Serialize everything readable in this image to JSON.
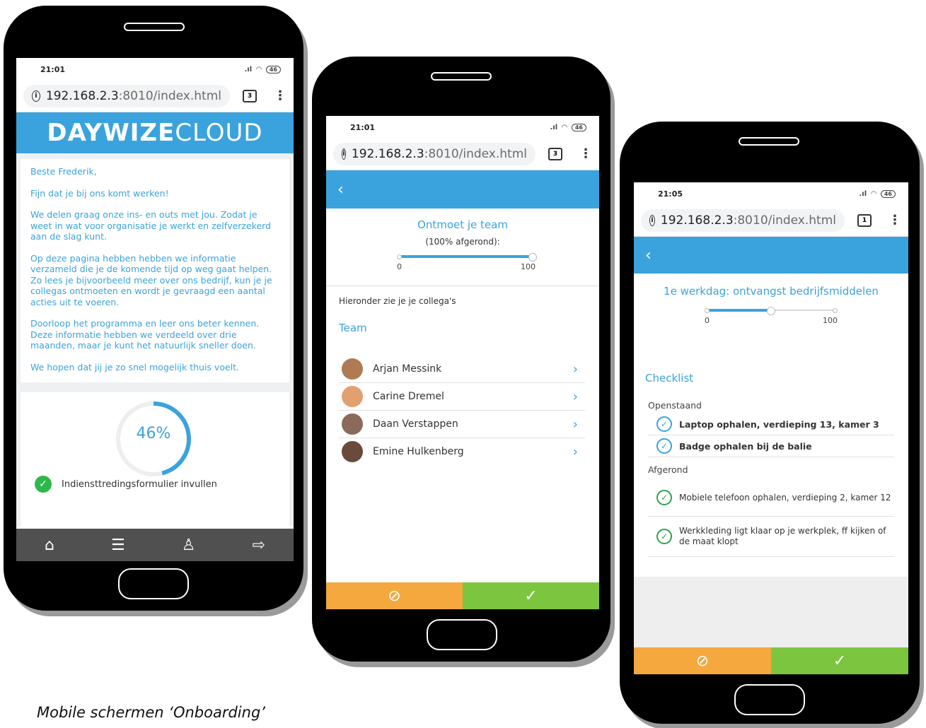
{
  "browser": {
    "url_host": "192.168.2.3",
    "url_rest": ":8010/index.html"
  },
  "phone1": {
    "time": "21:01",
    "battery": "46",
    "tab_count": "3",
    "brand_bold": "DAYWIZE",
    "brand_light": "CLOUD",
    "greeting": "Beste Frederik,",
    "paragraphs": [
      "Fijn dat je bij ons komt werken!",
      "We delen graag onze ins- en outs met jou. Zodat je weet in wat voor organisatie je werkt en zelfverzekerd aan de slag kunt.",
      "Op deze pagina hebben hebben we informatie verzameld die je de komende tijd op weg gaat helpen.\nZo lees je bijvoorbeeld meer over ons bedrijf, kun je je collegas ontmoeten en wordt je gevraagd een aantal acties uit te voeren.",
      "Doorloop het programma en leer ons beter kennen. Deze informatie hebben we verdeeld over drie maanden, maar je kunt het natuurlijk sneller doen.",
      "We hopen dat jij je zo snel mogelijk thuis voelt."
    ],
    "progress_percent": 46,
    "progress_label": "46%",
    "task_label": "Indiensttredingsformulier invullen",
    "nav": [
      "home-icon",
      "checklist-icon",
      "user-icon",
      "logout-icon"
    ]
  },
  "phone2": {
    "time": "21:01",
    "battery": "46",
    "tab_count": "3",
    "back": "‹",
    "title": "Ontmoet je team",
    "subtitle": "(100% afgerond):",
    "slider_value": 100,
    "slider_min": "0",
    "slider_max": "100",
    "intro": "Hieronder zie je je collega's",
    "section": "Team",
    "members": [
      {
        "name": "Arjan Messink",
        "color": "#b07a52"
      },
      {
        "name": "Carine Dremel",
        "color": "#e0a070"
      },
      {
        "name": "Daan Verstappen",
        "color": "#8a6a5a"
      },
      {
        "name": "Emine Hulkenberg",
        "color": "#6a4a3a"
      }
    ],
    "cancel_icon": "⊘",
    "ok_icon": "✓"
  },
  "phone3": {
    "time": "21:05",
    "battery": "46",
    "tab_count": "1",
    "back": "‹",
    "title": "1e werkdag: ontvangst bedrijfsmiddelen",
    "slider_value": 50,
    "slider_min": "0",
    "slider_max": "100",
    "section": "Checklist",
    "open_label": "Openstaand",
    "open_items": [
      "Laptop ophalen, verdieping 13, kamer 3",
      "Badge ophalen bij de balie"
    ],
    "done_label": "Afgerond",
    "done_items": [
      "Mobiele telefoon ophalen, verdieping 2, kamer 12",
      "Werkkleding ligt klaar op je werkplek, ff kijken of de maat klopt"
    ],
    "cancel_icon": "⊘",
    "ok_icon": "✓"
  },
  "caption": "Mobile schermen ‘Onboarding’",
  "colors": {
    "accent": "#3aa3dd",
    "orange": "#f4a83e",
    "green": "#7cc63f"
  }
}
